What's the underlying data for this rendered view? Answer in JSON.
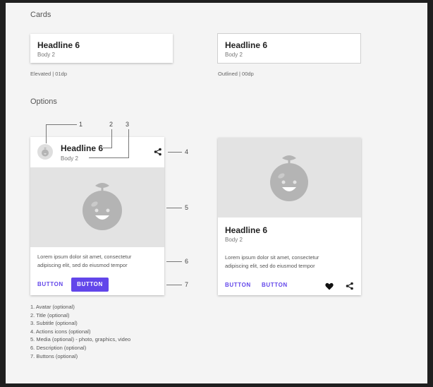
{
  "sections": {
    "cards_title": "Cards",
    "options_title": "Options"
  },
  "cards": {
    "elevated": {
      "headline": "Headline 6",
      "body": "Body 2",
      "caption": "Elevated | 01dp"
    },
    "outlined": {
      "headline": "Headline 6",
      "body": "Body 2",
      "caption": "Outlined | 00dp"
    }
  },
  "option_card_1": {
    "headline": "Headline 6",
    "body": "Body 2",
    "description_line1": "Lorem ipsum dolor sit amet, consectetur",
    "description_line2": "adipiscing elit, sed do eiusmod tempor",
    "button_text": "BUTTON",
    "button_filled": "BUTTON",
    "icons": {
      "avatar": "avatar-icon",
      "share": "share-icon",
      "media": "fruit-face-illustration"
    }
  },
  "option_card_2": {
    "headline": "Headline 6",
    "body": "Body 2",
    "description_line1": "Lorem ipsum dolor sit amet, consectetur",
    "description_line2": "adipiscing elit, sed do eiusmod tempor",
    "button_1": "BUTTON",
    "button_2": "BUTTON",
    "icons": {
      "heart": "heart-icon",
      "share": "share-icon",
      "media": "fruit-face-illustration"
    }
  },
  "callouts": [
    "1",
    "2",
    "3",
    "4",
    "5",
    "6",
    "7"
  ],
  "legend": [
    "1. Avatar (optional)",
    "2. Title (optional)",
    "3. Subtitle (optional)",
    "4. Actions icons (optional)",
    "5. Media (optional) - photo, graphics, video",
    "6. Description (optional)",
    "7. Buttons (optional)"
  ],
  "colors": {
    "accent": "#6246ea",
    "media_bg": "#e3e3e3",
    "illustration": "#b4b4b4",
    "page_bg": "#f4f4f4"
  }
}
